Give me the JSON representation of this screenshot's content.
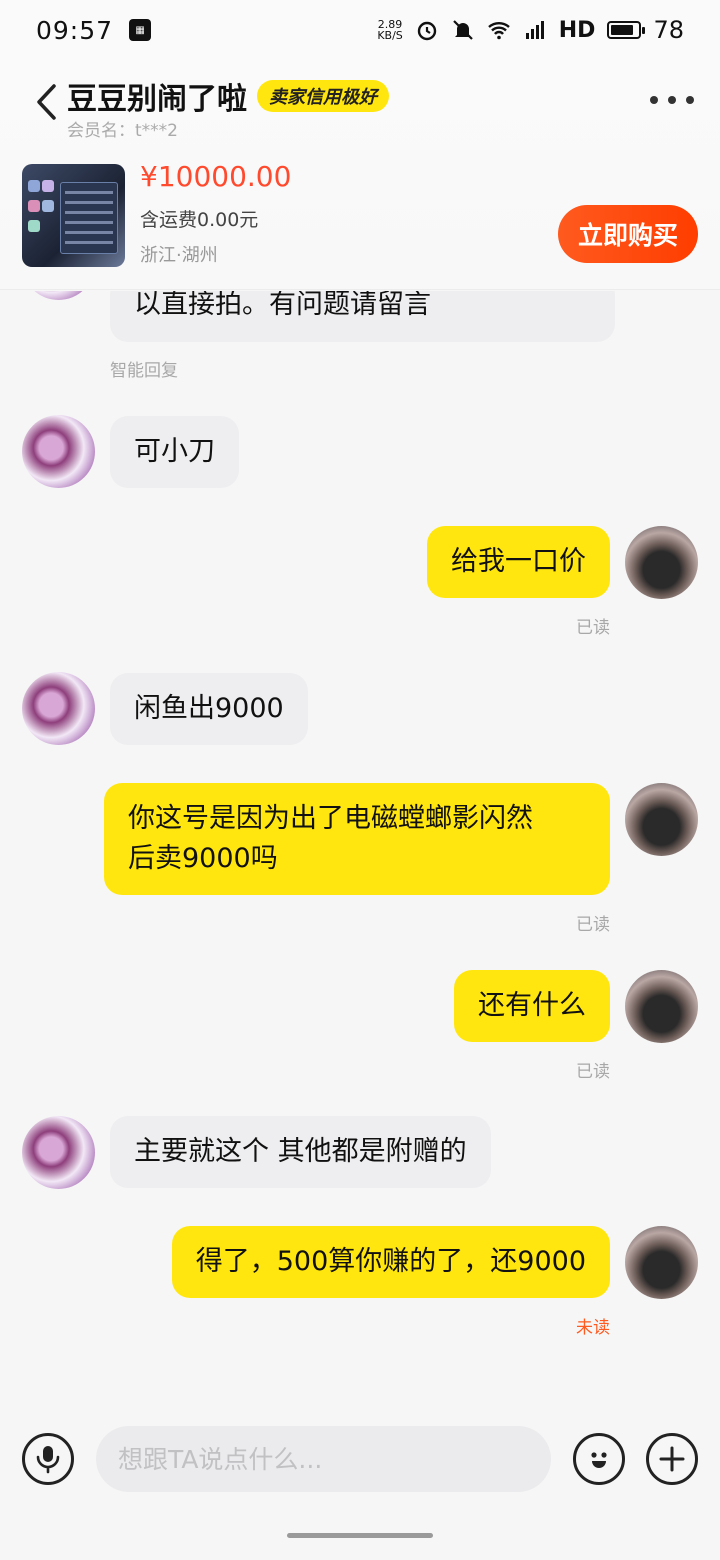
{
  "status_bar": {
    "time": "09:57",
    "net_speed_value": "2.89",
    "net_speed_unit": "KB/S",
    "network_label": "HD",
    "battery": "78",
    "battery_fill_fraction": 0.78
  },
  "header": {
    "seller_name": "豆豆别闹了啦",
    "credit_badge": "卖家信用极好",
    "member_label": "会员名：t***2"
  },
  "product": {
    "price": "¥10000.00",
    "shipping": "含运费0.00元",
    "location": "浙江·湖州",
    "buy_label": "立即购买"
  },
  "messages": [
    {
      "side": "left",
      "text": "以直接拍。有问题请留言",
      "meta": "智能回复"
    },
    {
      "side": "left",
      "text": "可小刀",
      "meta": ""
    },
    {
      "side": "right",
      "text": "给我一口价",
      "meta": "已读"
    },
    {
      "side": "left",
      "text": "闲鱼出9000",
      "meta": ""
    },
    {
      "side": "right",
      "text": "你这号是因为出了电磁螳螂影闪然\n后卖9000吗",
      "meta": "已读"
    },
    {
      "side": "right",
      "text": "还有什么",
      "meta": "已读"
    },
    {
      "side": "left",
      "text": "主要就这个 其他都是附赠的",
      "meta": ""
    },
    {
      "side": "right",
      "text": "得了，500算你赚的了，还9000",
      "meta": "未读"
    }
  ],
  "input": {
    "placeholder": "想跟TA说点什么..."
  },
  "icons": {
    "back": "chevron-left-icon",
    "more": "more-dots-icon",
    "voice": "microphone-icon",
    "emoji": "emoji-icon",
    "plus": "plus-icon"
  },
  "colors": {
    "accent_yellow": "#ffe60f",
    "price_red": "#ff4a2e",
    "buy_orange": "#ff4a10",
    "unread_orange": "#ff5a1f"
  }
}
